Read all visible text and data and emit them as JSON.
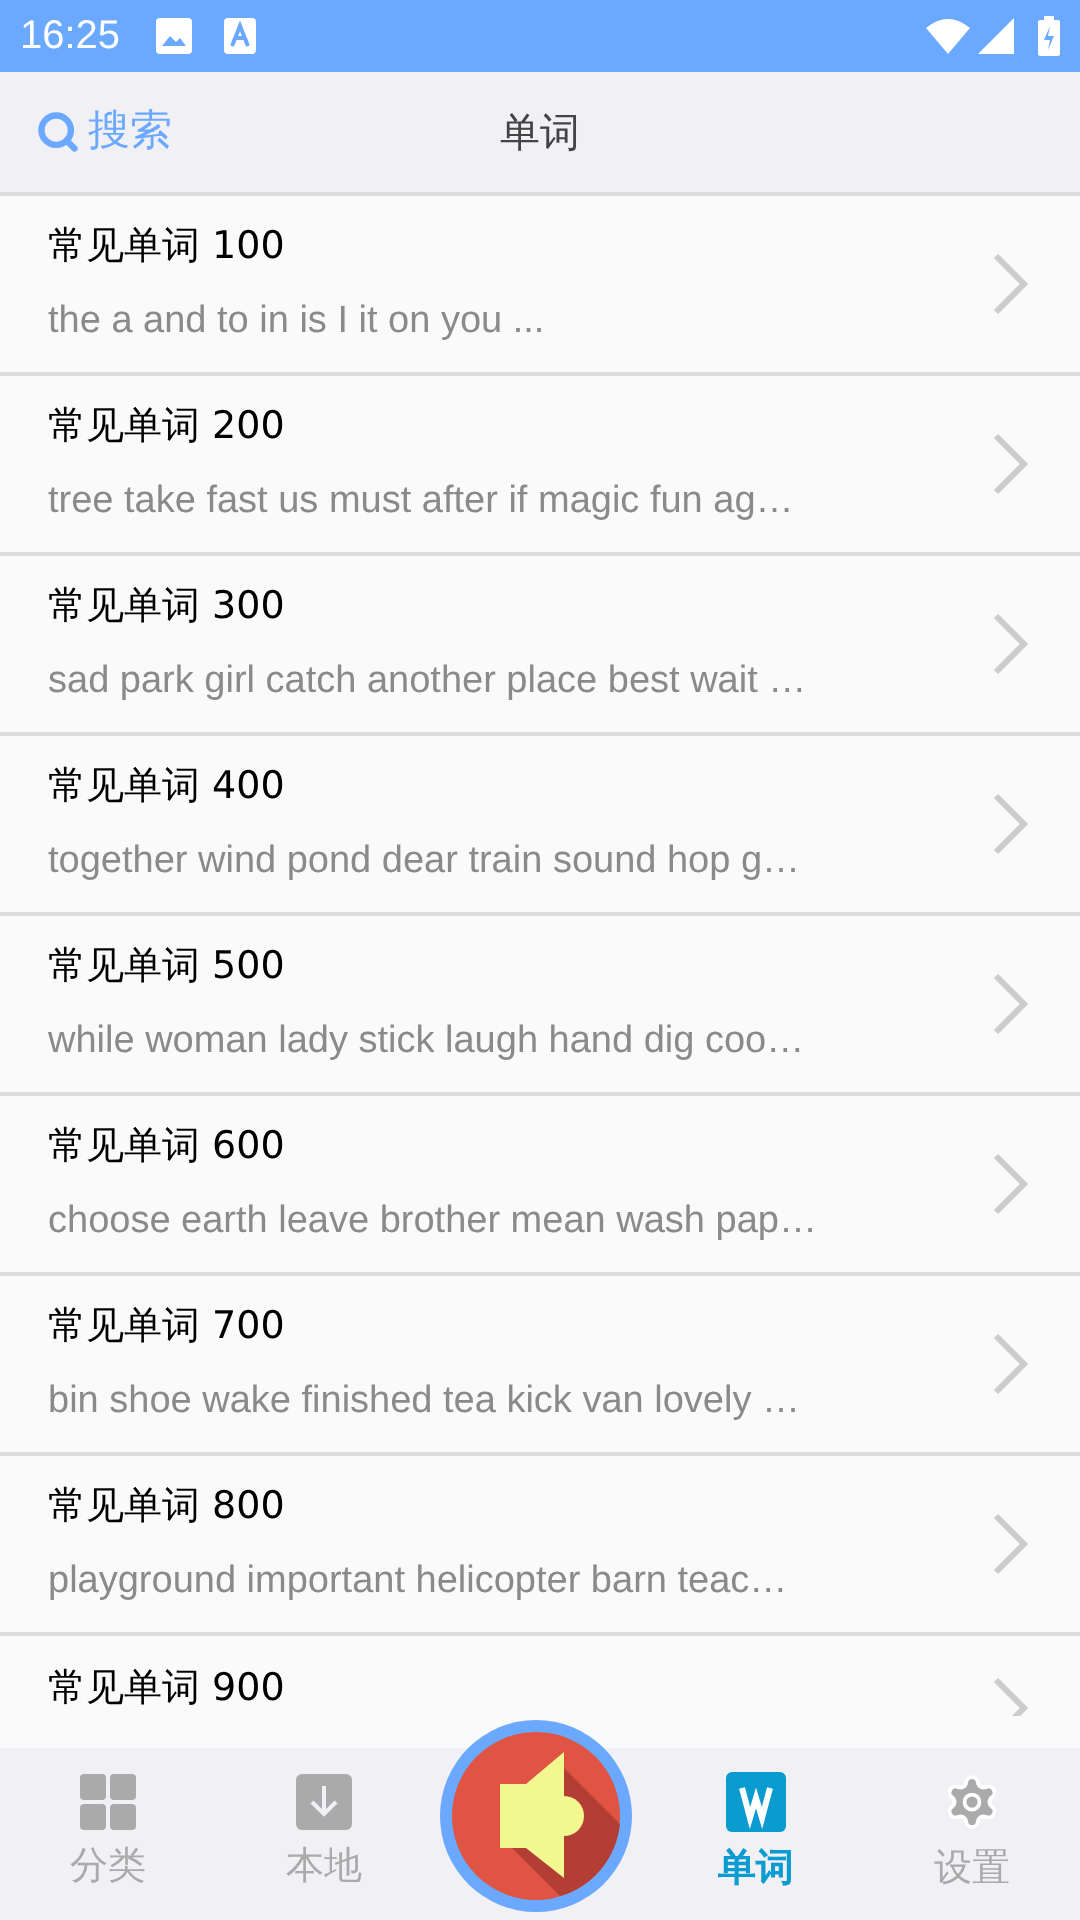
{
  "status_bar": {
    "time": "16:25"
  },
  "header": {
    "search_label": "搜索",
    "title": "单词"
  },
  "lists": [
    {
      "title": "常见单词 100",
      "subtitle": "the a and to in is I it on you ..."
    },
    {
      "title": "常见单词 200",
      "subtitle": "tree take fast us must after if magic fun ag…"
    },
    {
      "title": "常见单词 300",
      "subtitle": "sad park girl catch another place best wait …"
    },
    {
      "title": "常见单词 400",
      "subtitle": "together wind pond dear train sound hop g…"
    },
    {
      "title": "常见单词 500",
      "subtitle": "while woman lady stick laugh hand dig coo…"
    },
    {
      "title": "常见单词 600",
      "subtitle": "choose earth leave brother mean wash pap…"
    },
    {
      "title": "常见单词 700",
      "subtitle": "bin shoe wake finished tea kick van lovely …"
    },
    {
      "title": "常见单词 800",
      "subtitle": "playground important helicopter barn teac…"
    },
    {
      "title": "常见单词 900"
    }
  ],
  "tab_bar": [
    {
      "kind": "grid",
      "label": "分类",
      "selected": false
    },
    {
      "kind": "download",
      "label": "本地",
      "selected": false
    },
    {
      "kind": "speaker"
    },
    {
      "kind": "word",
      "label": "单词",
      "selected": true
    },
    {
      "kind": "gear",
      "label": "设置",
      "selected": false
    }
  ]
}
